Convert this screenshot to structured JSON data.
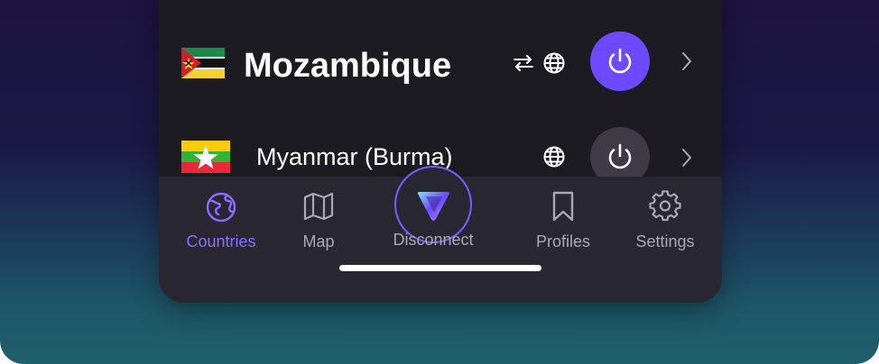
{
  "countries": [
    {
      "name": "Mozambique",
      "flag_icon": "mozambique-flag-icon",
      "connected": true
    },
    {
      "name": "Myanmar (Burma)",
      "flag_icon": "myanmar-flag-icon",
      "connected": false
    }
  ],
  "tabs": [
    {
      "label": "Countries",
      "icon": "globe-icon",
      "active": true
    },
    {
      "label": "Map",
      "icon": "map-icon",
      "active": false
    },
    {
      "label": "Disconnect",
      "icon": "proton-logo-icon",
      "active": false
    },
    {
      "label": "Profiles",
      "icon": "bookmark-icon",
      "active": false
    },
    {
      "label": "Settings",
      "icon": "gear-icon",
      "active": false
    }
  ],
  "colors": {
    "accent": "#6d4aff",
    "active_tab": "#8a6eff",
    "inactive_tab": "#a9a8b4",
    "panel": "#1d1b22",
    "tabbar": "#292731"
  }
}
